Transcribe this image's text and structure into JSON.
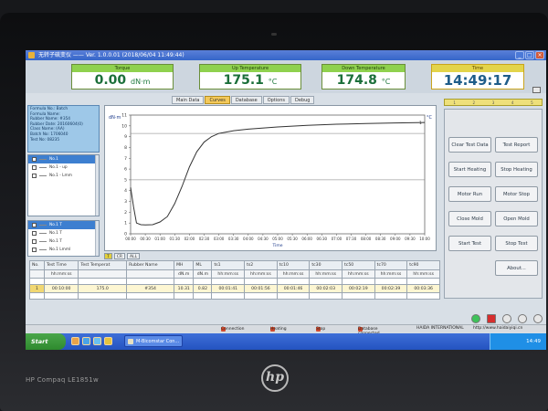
{
  "window": {
    "title": "无转子硫变仪 —— Ver. 1.0.0.01 (2018/06/04 11:49:44)"
  },
  "readouts": {
    "torque": {
      "label": "Torque",
      "value": "0.00",
      "unit": "dN·m"
    },
    "up_temp": {
      "label": "Up Temperature",
      "value": "175.1",
      "unit": "°C"
    },
    "down_temp": {
      "label": "Down Temperature",
      "value": "174.8",
      "unit": "°C"
    },
    "time": {
      "label": "Time",
      "value": "14:49:17"
    }
  },
  "info_panel": {
    "lines": [
      "Formula No.: Batch",
      "Formula Name:",
      "Rubber Name: #354",
      "Rubber Date: 20160604(0)",
      "Class Name: (AA)",
      "Batch No: 1706040",
      "Test No: 08235"
    ]
  },
  "curve_list": {
    "items": [
      {
        "label": "No.1",
        "selected": true
      },
      {
        "label": "No.1 - up",
        "selected": false
      },
      {
        "label": "No.1 - Lmm",
        "selected": false
      }
    ]
  },
  "curve_list2": {
    "items": [
      {
        "label": "No.1 T",
        "selected": true
      },
      {
        "label": "No.1 T",
        "selected": false
      },
      {
        "label": "No.1 T",
        "selected": false
      },
      {
        "label": "No.1 Lmml",
        "selected": false
      }
    ]
  },
  "tabs": [
    "Main Data",
    "Curves",
    "Database",
    "Options",
    "Debug"
  ],
  "active_tab": "Curves",
  "chart_toggles": [
    "T",
    "CR",
    "ALL"
  ],
  "progress_strip": [
    "1",
    "2",
    "3",
    "4",
    "5"
  ],
  "controls": {
    "clear_test_data": "Clear Test Data",
    "test_report": "Test Report",
    "start_heating": "Start Heating",
    "stop_heating": "Stop Heating",
    "motor_run": "Motor Run",
    "motor_stop": "Motor Stop",
    "close_mold": "Close Mold",
    "open_mold": "Open Mold",
    "start_test": "Start Test",
    "stop_test": "Stop Test",
    "about": "About..."
  },
  "results_table": {
    "headers": [
      "No.",
      "Test Time",
      "Test Temperat",
      "Rubber Name",
      "MH",
      "ML",
      "ts1",
      "ts2",
      "tc10",
      "tc30",
      "tc50",
      "tc70",
      "tc90"
    ],
    "units": [
      "",
      "hh:mm:ss",
      "",
      "",
      "dN.m",
      "dN.m",
      "hh:mm:ss",
      "hh:mm:ss",
      "hh:mm:ss",
      "hh:mm:ss",
      "hh:mm:ss",
      "hh:mm:ss",
      "hh:mm:ss"
    ],
    "rows": [
      [
        "1",
        "00:10:00",
        "175.0",
        "#354",
        "10.31",
        "0.82",
        "00:01:41",
        "00:01:56",
        "00:01:46",
        "00:02:03",
        "00:02:19",
        "00:02:39",
        "00:03:36"
      ]
    ]
  },
  "status_bar": {
    "connection": "Connection",
    "heating": "Heating",
    "stop": "Stop",
    "database": "Database connected",
    "company": "HAIDA INTERNATIONAL",
    "url": "http://www.haidaiyiqi.cn"
  },
  "taskbar": {
    "start": "Start",
    "task1": "M-Bicomstar Con...",
    "time": "14:49"
  },
  "monitor": {
    "brand": "hp",
    "model": "HP Compaq LE1851w"
  },
  "colors": {
    "curve": "#333333",
    "readout_value": "#1b6f3a",
    "active_tab": "#f4c95a",
    "taskbar": "#2453c0"
  },
  "chart_data": {
    "type": "line",
    "title": "",
    "xlabel": "Time",
    "ylabel": "dN·m",
    "right_label": "°C",
    "ylim": [
      0,
      11
    ],
    "yticks": [
      "0",
      "1",
      "2",
      "3",
      "4",
      "5",
      "6",
      "7",
      "8",
      "9",
      "10",
      "11"
    ],
    "xticks": [
      "00:00",
      "00:30",
      "01:00",
      "01:30",
      "02:00",
      "02:30",
      "03:00",
      "03:30",
      "04:00",
      "04:30",
      "05:00",
      "05:30",
      "06:00",
      "06:30",
      "07:00",
      "07:30",
      "08:00",
      "08:30",
      "09:00",
      "09:30",
      "10:00"
    ],
    "reference_lines": [
      5.0,
      9.3
    ],
    "series": [
      {
        "name": "1",
        "x": [
          0.0,
          0.1,
          0.2,
          0.35,
          0.5,
          0.75,
          1.0,
          1.25,
          1.5,
          1.75,
          2.0,
          2.25,
          2.5,
          2.75,
          3.0,
          3.5,
          4.0,
          5.0,
          6.0,
          7.0,
          8.0,
          9.0,
          10.0
        ],
        "y": [
          4.3,
          2.5,
          1.0,
          0.85,
          0.82,
          0.85,
          1.1,
          1.6,
          2.8,
          4.4,
          6.2,
          7.6,
          8.5,
          9.0,
          9.3,
          9.55,
          9.7,
          9.9,
          10.05,
          10.15,
          10.22,
          10.27,
          10.31
        ]
      }
    ]
  }
}
